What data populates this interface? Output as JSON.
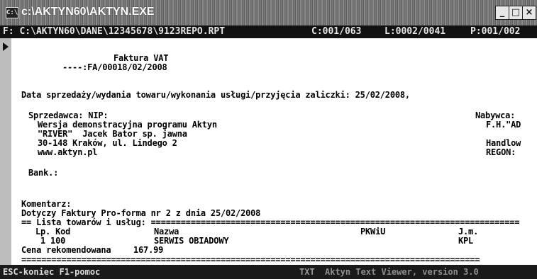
{
  "window": {
    "title": "c:\\AKTYN60\\AKTYN.EXE",
    "icon_label": "C:\\",
    "buttons": [
      "_",
      "□",
      "×"
    ]
  },
  "status": {
    "path": "F: C:\\AKTYN60\\DANE\\12345678\\9123REPO.RPT",
    "col": "C:001/063",
    "line": "L:0002/0041",
    "page": "P:001/002"
  },
  "document": {
    "title": "Faktura VAT",
    "number": "----:FA/00018/02/2008",
    "sale_date": "Data sprzedaży/wydania towaru/wykonania usługi/przyjęcia zaliczki: 25/02/2008,",
    "seller_header": "Sprzedawca: NIP:",
    "seller_lines": [
      "Wersja demonstracyjna programu Aktyn",
      "\"RIVER\"  Jacek Bator sp. jawna",
      "30-148 Kraków, ul. Lindego 2",
      "www.aktyn.pl"
    ],
    "buyer_lines": [
      "Nabywca:",
      "F.H.\"AD",
      "",
      "Handlow",
      "REGON:"
    ],
    "bank": "Bank.:",
    "comment_label": "Komentarz:",
    "comment_text": "Dotyczy Faktury Pro-forma nr 2 z dnia 25/02/2008",
    "items_header": "== Lista towarów i usług: ==========================================================================",
    "columns": {
      "lp_kod": "Lp. Kod",
      "nazwa": "Nazwa",
      "pkwiu": "PKWiU",
      "jm": "J.m."
    },
    "item": {
      "lp_kod": "1 100",
      "nazwa": "SERWIS OBIADOWY",
      "jm": "KPL"
    },
    "recommended_price_label": "Cena rekomendowana",
    "recommended_price": "167.99",
    "separator": "============================================================================================"
  },
  "footer": {
    "keys": "ESC-koniec  F1-pomoc",
    "mode": "TXT",
    "viewer": "Aktyn Text Viewer, version 3.0"
  }
}
